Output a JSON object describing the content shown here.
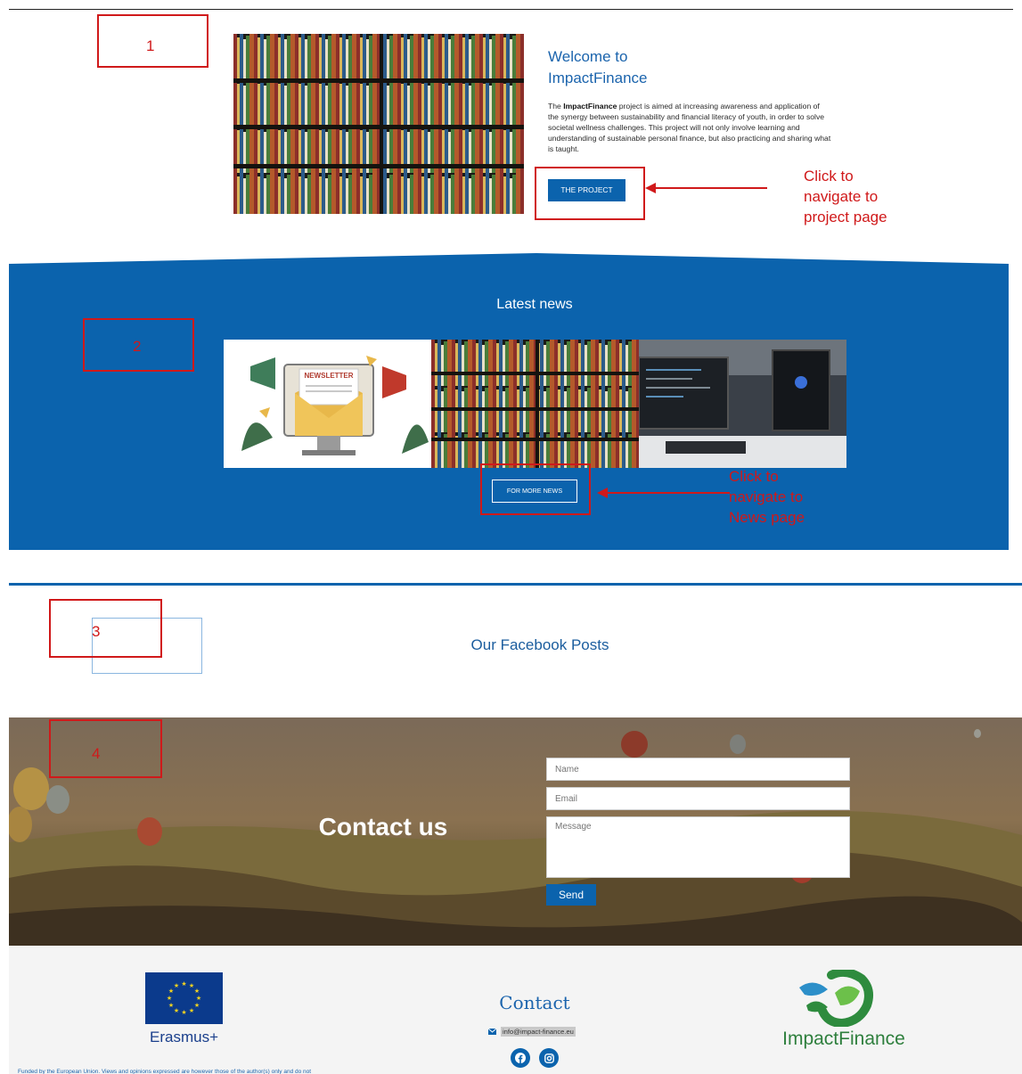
{
  "welcome": {
    "title": "Welcome to ImpactFinance",
    "desc_bold": "ImpactFinance",
    "desc_pre": "The ",
    "desc_rest": " project is aimed at increasing awareness and application of the synergy between sustainability and financial literacy of youth, in order to solve societal wellness challenges. This project will not only involve learning and understanding of sustainable personal finance, but also practicing and sharing what is taught.",
    "button": "THE PROJECT"
  },
  "news": {
    "title": "Latest news",
    "newsletter_label": "NEWSLETTER",
    "button": "FOR MORE NEWS"
  },
  "facebook": {
    "title": "Our Facebook Posts"
  },
  "contact": {
    "title": "Contact us",
    "name_placeholder": "Name",
    "email_placeholder": "Email",
    "message_placeholder": "Message",
    "send": "Send"
  },
  "footer": {
    "erasmus": "Erasmus+",
    "contact_heading": "Contact",
    "email": "info@impact-finance.eu",
    "brand": "ImpactFinance",
    "disclaimer": "Funded by the European Union. Views and opinions expressed are however those of the author(s) only and do not"
  },
  "annotations": {
    "n1": "1",
    "n2": "2",
    "n3": "3",
    "n4": "4",
    "project_note": "Click to navigate to project page",
    "news_note": "Click to navigate to News page"
  },
  "icons": [
    "envelope-icon",
    "facebook-icon",
    "instagram-icon",
    "eu-flag-icon",
    "impactfinance-logo-icon"
  ],
  "colors": {
    "brand_blue": "#0b63ad",
    "annotation_red": "#d0191a",
    "brand_green": "#2e7f3d"
  }
}
